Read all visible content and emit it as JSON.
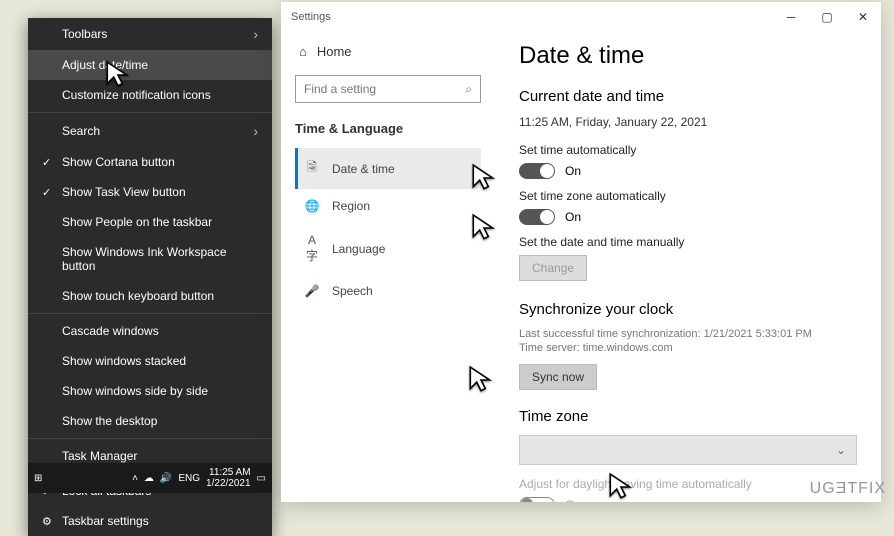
{
  "context_menu": {
    "items": [
      {
        "label": "Toolbars",
        "arrow": true
      },
      {
        "label": "Adjust date/time",
        "highlighted": true
      },
      {
        "label": "Customize notification icons"
      },
      {
        "sep": true
      },
      {
        "label": "Search",
        "arrow": true
      },
      {
        "label": "Show Cortana button",
        "checked": true
      },
      {
        "label": "Show Task View button",
        "checked": true
      },
      {
        "label": "Show People on the taskbar"
      },
      {
        "label": "Show Windows Ink Workspace button"
      },
      {
        "label": "Show touch keyboard button"
      },
      {
        "sep": true
      },
      {
        "label": "Cascade windows"
      },
      {
        "label": "Show windows stacked"
      },
      {
        "label": "Show windows side by side"
      },
      {
        "label": "Show the desktop"
      },
      {
        "sep": true
      },
      {
        "label": "Task Manager"
      },
      {
        "sep": true
      },
      {
        "label": "Lock all taskbars",
        "checked": true
      },
      {
        "label": "Taskbar settings",
        "gear": true
      }
    ]
  },
  "taskbar": {
    "lang": "ENG",
    "time": "11:25 AM",
    "date": "1/22/2021"
  },
  "settings_window": {
    "title": "Settings",
    "home_label": "Home",
    "search_placeholder": "Find a setting",
    "section_head": "Time & Language",
    "sidebar_items": [
      {
        "icon": "🗟",
        "label": "Date & time",
        "active": true
      },
      {
        "icon": "🌐",
        "label": "Region"
      },
      {
        "icon": "A字",
        "label": "Language"
      },
      {
        "icon": "🎤",
        "label": "Speech"
      }
    ],
    "page": {
      "heading": "Date & time",
      "subheading": "Current date and time",
      "current": "11:25 AM, Friday, January 22, 2021",
      "set_time_auto_label": "Set time automatically",
      "set_time_auto_state": "On",
      "set_zone_auto_label": "Set time zone automatically",
      "set_zone_auto_state": "On",
      "manual_label": "Set the date and time manually",
      "change_btn": "Change",
      "sync_head": "Synchronize your clock",
      "sync_last": "Last successful time synchronization: 1/21/2021 5:33:01 PM",
      "sync_server": "Time server: time.windows.com",
      "sync_btn": "Sync now",
      "tz_head": "Time zone",
      "dst_label": "Adjust for daylight saving time automatically",
      "dst_state": "On"
    }
  },
  "watermark": "UGƎTFIX"
}
